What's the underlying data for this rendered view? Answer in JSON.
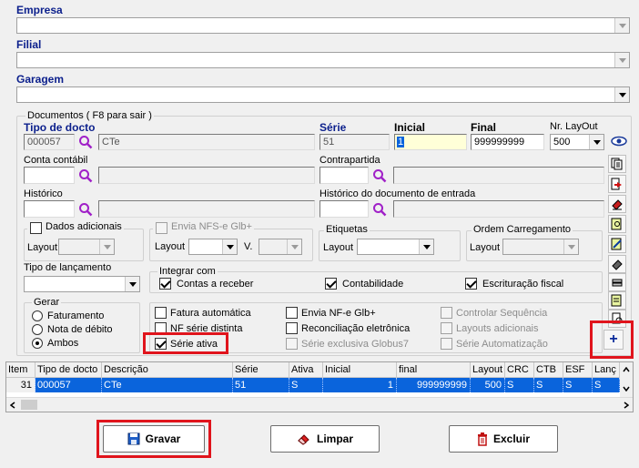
{
  "empresa": {
    "label": "Empresa"
  },
  "filial": {
    "label": "Filial"
  },
  "garagem": {
    "label": "Garagem"
  },
  "documentos": {
    "title": "Documentos ( F8 para sair )",
    "tipo_docto": {
      "label": "Tipo de docto",
      "code": "000057",
      "desc": "CTe"
    },
    "serie": {
      "label": "Série",
      "value": "51"
    },
    "inicial": {
      "label": "Inicial",
      "value": "1"
    },
    "final": {
      "label": "Final",
      "value": "999999999"
    },
    "nr_layout": {
      "label": "Nr. LayOut",
      "value": "500"
    },
    "conta_contabil": {
      "label": "Conta contábil"
    },
    "contrapartida": {
      "label": "Contrapartida"
    },
    "historico": {
      "label": "Histórico"
    },
    "historico_entrada": {
      "label": "Histórico do documento de entrada"
    },
    "dados_adicionais": {
      "label": "Dados adicionais",
      "layout": "Layout"
    },
    "envia_nfse": {
      "label": "Envia NFS-e Glb+",
      "layout": "Layout",
      "v": "V."
    },
    "etiquetas": {
      "title": "Etiquetas",
      "layout": "Layout"
    },
    "ordem": {
      "title": "Ordem Carregamento",
      "layout": "Layout"
    },
    "tipo_lancamento": {
      "label": "Tipo de lançamento"
    },
    "integrar": {
      "title": "Integrar com",
      "contas_receber": "Contas a receber",
      "contabilidade": "Contabilidade",
      "escrituracao": "Escrituração fiscal"
    },
    "gerar": {
      "title": "Gerar",
      "faturamento": "Faturamento",
      "nota_debito": "Nota de débito",
      "ambos": "Ambos"
    },
    "options": {
      "fatura_automatica": "Fatura automática",
      "nf_serie_distinta": "NF série distinta",
      "serie_ativa": "Série ativa",
      "envia_nfe": "Envia NF-e Glb+",
      "reconciliacao": "Reconciliação eletrônica",
      "serie_exclusiva": "Série exclusiva Globus7",
      "controlar_sequencia": "Controlar Sequência",
      "layouts_adicionais": "Layouts adicionais",
      "serie_automatizacao": "Série Automatização"
    },
    "add_symbol": "+"
  },
  "grid": {
    "headers": [
      "Item",
      "Tipo de docto",
      "Descrição",
      "Série",
      "Ativa",
      "Inicial",
      "final",
      "Layout",
      "CRC",
      "CTB",
      "ESF",
      "Lanç"
    ],
    "row": [
      "31",
      "000057",
      "CTe",
      "51",
      "S",
      "1",
      "999999999",
      "500",
      "S",
      "S",
      "S",
      "S"
    ]
  },
  "buttons": {
    "gravar": "Gravar",
    "limpar": "Limpar",
    "excluir": "Excluir"
  },
  "colors": {
    "label_blue": "#0b1f8c",
    "highlight_red": "#e0141c",
    "selection_blue": "#0a64dc"
  }
}
